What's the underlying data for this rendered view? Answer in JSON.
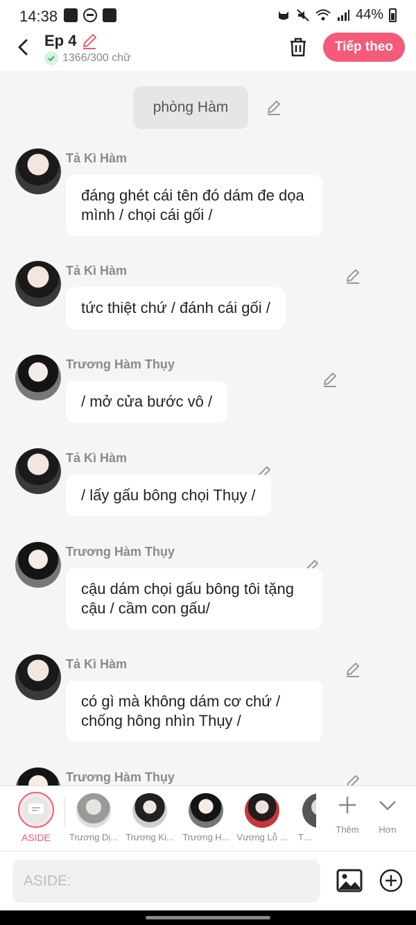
{
  "status": {
    "time": "14:38",
    "battery": "44%"
  },
  "header": {
    "title": "Ep 4",
    "word_count": "1366/300 chữ",
    "next_label": "Tiếp theo"
  },
  "scene": {
    "label": "phòng Hàm"
  },
  "messages": [
    {
      "sender": "Tả Kì Hàm",
      "text": "đáng ghét cái tên đó dám đe dọa mình / chọi cái gối /"
    },
    {
      "sender": "Tả Kì Hàm",
      "text": "tức thiệt chứ / đánh cái gối /"
    },
    {
      "sender": "Trương Hàm Thụy",
      "text": "/ mở cửa bước vô /"
    },
    {
      "sender": "Tả Kì Hàm",
      "text": "/ lấy gấu bông chọi Thụy /"
    },
    {
      "sender": "Trương Hàm Thụy",
      "text": "cậu dám chọi gấu bông tôi tặng cậu / cầm con gấu/"
    },
    {
      "sender": "Tả Kì Hàm",
      "text": "có gì mà không dám cơ chứ / chống hông nhìn Thụy /"
    },
    {
      "sender": "Trương Hàm Thụy",
      "text": ""
    }
  ],
  "characters": {
    "aside_label": "ASIDE",
    "items": [
      {
        "name": "Trương Dị..."
      },
      {
        "name": "Trương Ki..."
      },
      {
        "name": "Trương H..."
      },
      {
        "name": "Vương Lỗ ..."
      },
      {
        "name": "Tả K"
      }
    ],
    "add_label": "Thêm",
    "more_label": "Hơn"
  },
  "input": {
    "placeholder": "ASIDE:"
  },
  "colors": {
    "accent": "#f45b78",
    "background": "#f5f5f5"
  }
}
